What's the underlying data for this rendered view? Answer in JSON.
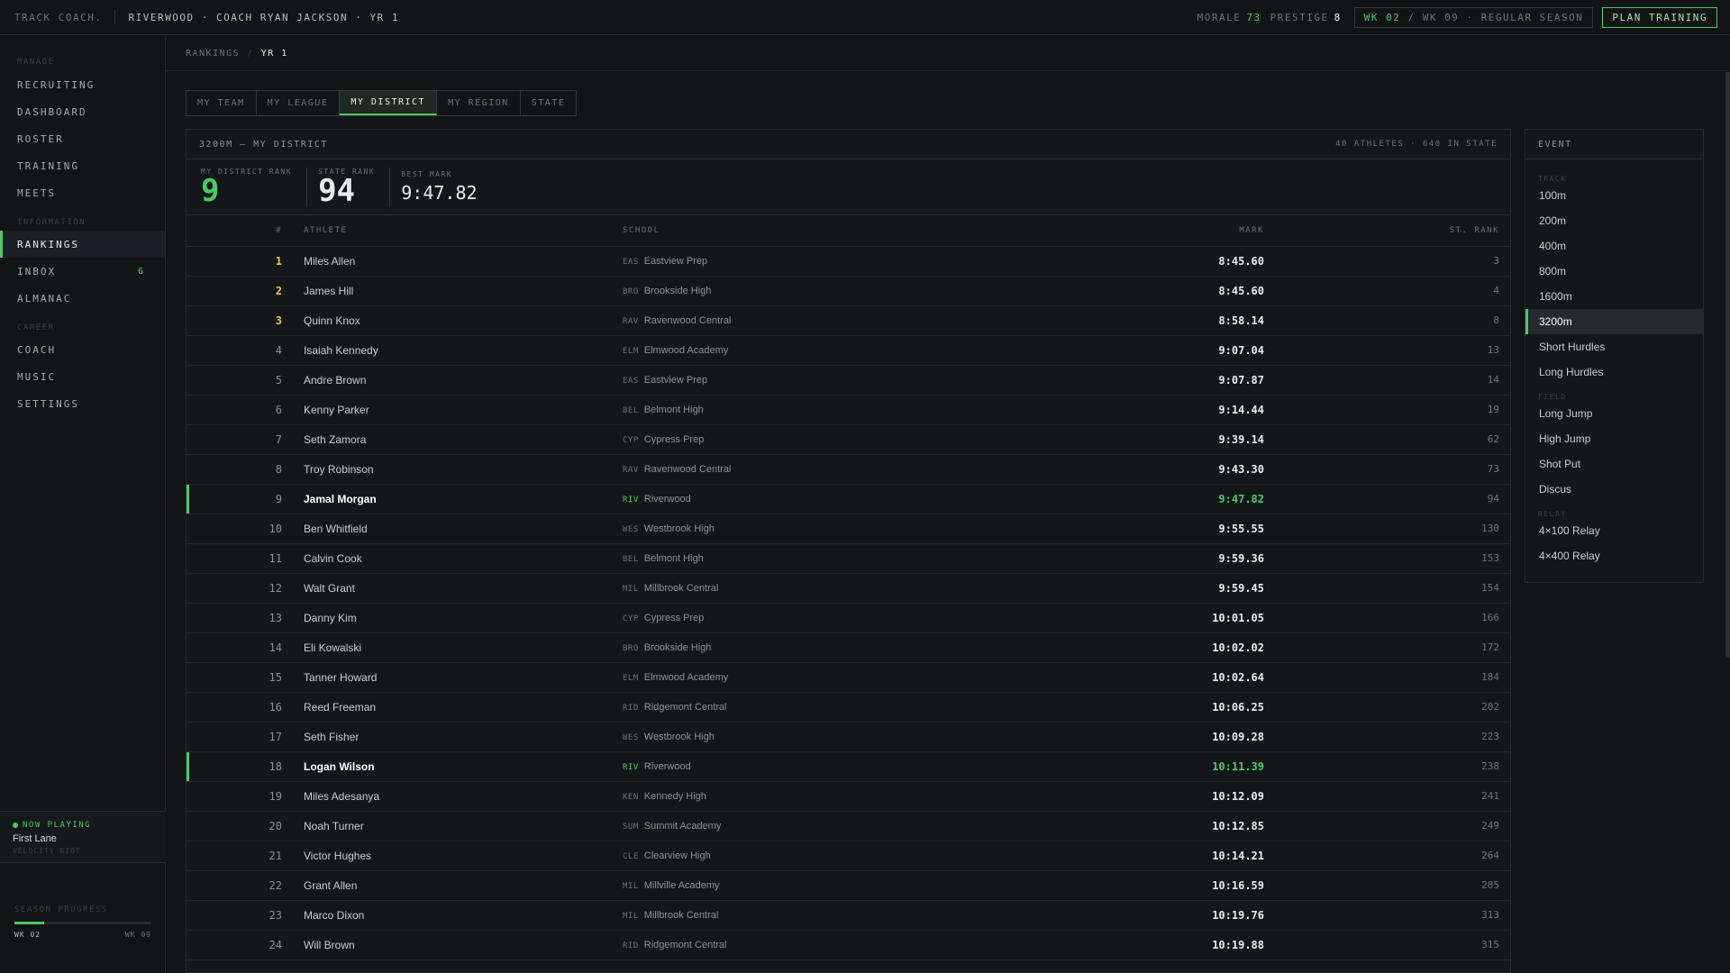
{
  "topbar": {
    "brand": "TRACK COACH.",
    "context": "RIVERWOOD · COACH RYAN JACKSON · YR 1",
    "morale_label": "MORALE",
    "morale_value": "73",
    "prestige_label": "PRESTIGE",
    "prestige_value": "8",
    "week_current": "WK 02",
    "week_rest": " / WK 09 · REGULAR SEASON",
    "plan_button": "PLAN TRAINING"
  },
  "sidebar": {
    "sections": [
      {
        "label": "MANAGE",
        "items": [
          {
            "label": "RECRUITING"
          },
          {
            "label": "DASHBOARD"
          },
          {
            "label": "ROSTER"
          },
          {
            "label": "TRAINING"
          },
          {
            "label": "MEETS"
          }
        ]
      },
      {
        "label": "INFORMATION",
        "items": [
          {
            "label": "RANKINGS",
            "active": true
          },
          {
            "label": "INBOX",
            "badge": "6"
          },
          {
            "label": "ALMANAC"
          }
        ]
      },
      {
        "label": "CAREER",
        "items": [
          {
            "label": "COACH"
          },
          {
            "label": "MUSIC"
          },
          {
            "label": "SETTINGS"
          }
        ]
      }
    ],
    "now_playing": {
      "label": "NOW PLAYING",
      "title": "First Lane",
      "artist": "VELOCITY RIOT"
    },
    "season": {
      "label": "SEASON PROGRESS",
      "start": "WK 02",
      "end": "WK 09",
      "progress": 0.22
    }
  },
  "breadcrumb": {
    "root": "RANKINGS",
    "current": "YR 1"
  },
  "tabs": [
    {
      "label": "MY TEAM"
    },
    {
      "label": "MY LEAGUE"
    },
    {
      "label": "MY DISTRICT",
      "active": true
    },
    {
      "label": "MY REGION"
    },
    {
      "label": "STATE"
    }
  ],
  "panel": {
    "title": "3200M — MY DISTRICT",
    "meta": "40 ATHLETES · 640 IN STATE",
    "summary": {
      "district_rank_label": "MY DISTRICT RANK",
      "district_rank": "9",
      "state_rank_label": "STATE RANK",
      "state_rank": "94",
      "best_mark_label": "BEST MARK",
      "best_mark": "9:47.82"
    },
    "columns": {
      "rank": "#",
      "athlete": "ATHLETE",
      "school": "SCHOOL",
      "mark": "MARK",
      "state_rank": "ST. RANK"
    },
    "rows": [
      {
        "rank": "1",
        "athlete": "Miles Allen",
        "abbr": "EAS",
        "school": "Eastview Prep",
        "mark": "8:45.60",
        "st": "3"
      },
      {
        "rank": "2",
        "athlete": "James Hill",
        "abbr": "BRO",
        "school": "Brookside High",
        "mark": "8:45.60",
        "st": "4"
      },
      {
        "rank": "3",
        "athlete": "Quinn Knox",
        "abbr": "RAV",
        "school": "Ravenwood Central",
        "mark": "8:58.14",
        "st": "8"
      },
      {
        "rank": "4",
        "athlete": "Isaiah Kennedy",
        "abbr": "ELM",
        "school": "Elmwood Academy",
        "mark": "9:07.04",
        "st": "13"
      },
      {
        "rank": "5",
        "athlete": "Andre Brown",
        "abbr": "EAS",
        "school": "Eastview Prep",
        "mark": "9:07.87",
        "st": "14"
      },
      {
        "rank": "6",
        "athlete": "Kenny Parker",
        "abbr": "BEL",
        "school": "Belmont High",
        "mark": "9:14.44",
        "st": "19"
      },
      {
        "rank": "7",
        "athlete": "Seth Zamora",
        "abbr": "CYP",
        "school": "Cypress Prep",
        "mark": "9:39.14",
        "st": "62"
      },
      {
        "rank": "8",
        "athlete": "Troy Robinson",
        "abbr": "RAV",
        "school": "Ravenwood Central",
        "mark": "9:43.30",
        "st": "73"
      },
      {
        "rank": "9",
        "athlete": "Jamal Morgan",
        "abbr": "RIV",
        "school": "Riverwood",
        "mark": "9:47.82",
        "st": "94",
        "mine": true
      },
      {
        "rank": "10",
        "athlete": "Ben Whitfield",
        "abbr": "WES",
        "school": "Westbrook High",
        "mark": "9:55.55",
        "st": "130"
      },
      {
        "rank": "11",
        "athlete": "Calvin Cook",
        "abbr": "BEL",
        "school": "Belmont High",
        "mark": "9:59.36",
        "st": "153"
      },
      {
        "rank": "12",
        "athlete": "Walt Grant",
        "abbr": "MIL",
        "school": "Millbrook Central",
        "mark": "9:59.45",
        "st": "154"
      },
      {
        "rank": "13",
        "athlete": "Danny Kim",
        "abbr": "CYP",
        "school": "Cypress Prep",
        "mark": "10:01.05",
        "st": "166"
      },
      {
        "rank": "14",
        "athlete": "Eli Kowalski",
        "abbr": "BRO",
        "school": "Brookside High",
        "mark": "10:02.02",
        "st": "172"
      },
      {
        "rank": "15",
        "athlete": "Tanner Howard",
        "abbr": "ELM",
        "school": "Elmwood Academy",
        "mark": "10:02.64",
        "st": "184"
      },
      {
        "rank": "16",
        "athlete": "Reed Freeman",
        "abbr": "RID",
        "school": "Ridgemont Central",
        "mark": "10:06.25",
        "st": "202"
      },
      {
        "rank": "17",
        "athlete": "Seth Fisher",
        "abbr": "WES",
        "school": "Westbrook High",
        "mark": "10:09.28",
        "st": "223"
      },
      {
        "rank": "18",
        "athlete": "Logan Wilson",
        "abbr": "RIV",
        "school": "Riverwood",
        "mark": "10:11.39",
        "st": "238",
        "mine": true
      },
      {
        "rank": "19",
        "athlete": "Miles Adesanya",
        "abbr": "KEN",
        "school": "Kennedy High",
        "mark": "10:12.09",
        "st": "241"
      },
      {
        "rank": "20",
        "athlete": "Noah Turner",
        "abbr": "SUM",
        "school": "Summit Academy",
        "mark": "10:12.85",
        "st": "249"
      },
      {
        "rank": "21",
        "athlete": "Victor Hughes",
        "abbr": "CLE",
        "school": "Clearview High",
        "mark": "10:14.21",
        "st": "264"
      },
      {
        "rank": "22",
        "athlete": "Grant Allen",
        "abbr": "MIL",
        "school": "Millville Academy",
        "mark": "10:16.59",
        "st": "285"
      },
      {
        "rank": "23",
        "athlete": "Marco Dixon",
        "abbr": "MIL",
        "school": "Millbrook Central",
        "mark": "10:19.76",
        "st": "313"
      },
      {
        "rank": "24",
        "athlete": "Will Brown",
        "abbr": "RID",
        "school": "Ridgemont Central",
        "mark": "10:19.88",
        "st": "315"
      }
    ]
  },
  "events": {
    "title": "EVENT",
    "groups": [
      {
        "label": "TRACK",
        "items": [
          {
            "label": "100m"
          },
          {
            "label": "200m"
          },
          {
            "label": "400m"
          },
          {
            "label": "800m"
          },
          {
            "label": "1600m"
          },
          {
            "label": "3200m",
            "active": true
          },
          {
            "label": "Short Hurdles"
          },
          {
            "label": "Long Hurdles"
          }
        ]
      },
      {
        "label": "FIELD",
        "items": [
          {
            "label": "Long Jump"
          },
          {
            "label": "High Jump"
          },
          {
            "label": "Shot Put"
          },
          {
            "label": "Discus"
          }
        ]
      },
      {
        "label": "RELAY",
        "items": [
          {
            "label": "4×100 Relay"
          },
          {
            "label": "4×400 Relay"
          }
        ]
      }
    ]
  },
  "colors": {
    "accent": "#4cc864",
    "gold": "#f0c53a",
    "background": "#121416"
  }
}
